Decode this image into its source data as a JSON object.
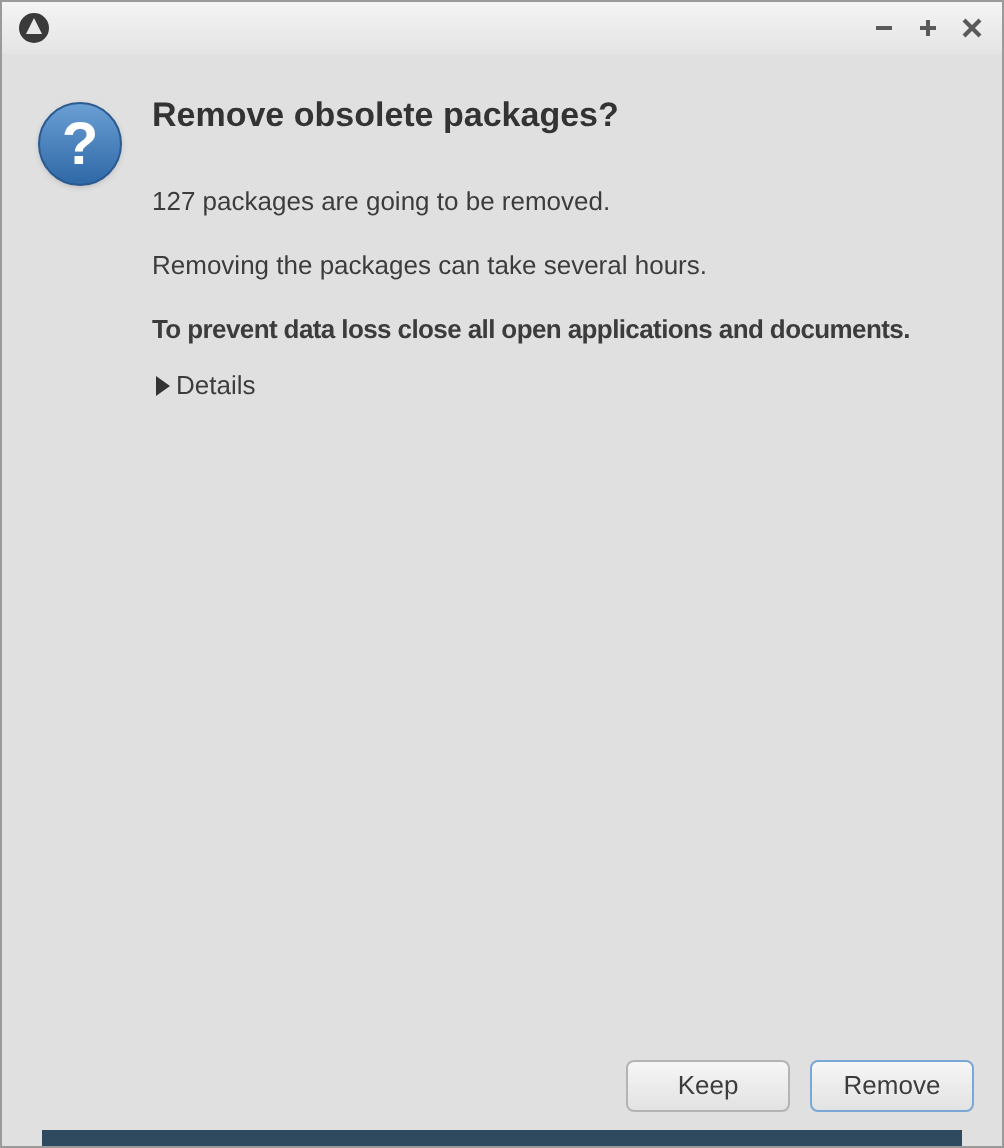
{
  "dialog": {
    "icon_glyph": "?",
    "heading": "Remove obsolete packages?",
    "messages": [
      {
        "text": "127 packages are going to be removed.",
        "bold": false
      },
      {
        "text": "Removing the packages can take several hours.",
        "bold": false
      },
      {
        "text": "To prevent data loss close all open applications and documents.",
        "bold": true
      }
    ],
    "details": {
      "label": "Details",
      "expanded": false
    }
  },
  "buttons": [
    {
      "label": "Keep",
      "focused": false
    },
    {
      "label": "Remove",
      "focused": true
    }
  ]
}
